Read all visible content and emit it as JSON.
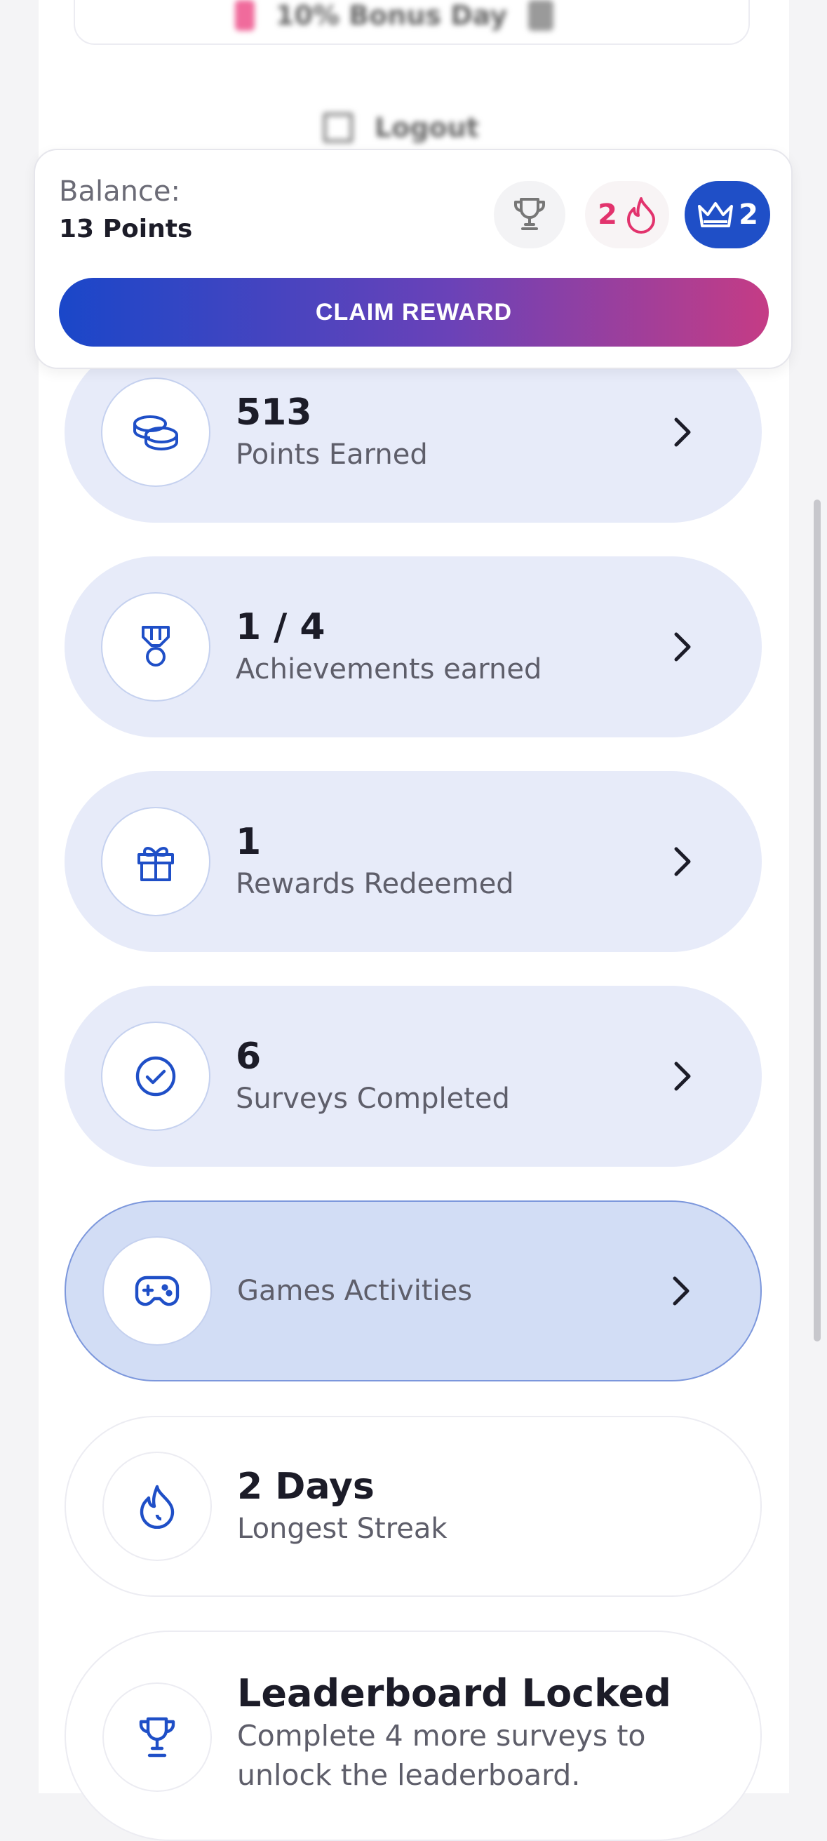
{
  "behind": {
    "bonus_text": "10% Bonus Day",
    "logout_text": "Logout"
  },
  "balance": {
    "label": "Balance:",
    "points": "13 Points",
    "streak_count": "2",
    "crown_count": "2",
    "claim_label": "CLAIM REWARD"
  },
  "stats": [
    {
      "value": "513",
      "label": "Points Earned",
      "icon": "coins-icon"
    },
    {
      "value": "1 / 4",
      "label": "Achievements earned",
      "icon": "medal-icon"
    },
    {
      "value": "1",
      "label": "Rewards Redeemed",
      "icon": "gift-icon"
    },
    {
      "value": "6",
      "label": "Surveys Completed",
      "icon": "check-circle-icon"
    },
    {
      "value": "",
      "label": "Games Activities",
      "icon": "gamepad-icon"
    },
    {
      "value": "2 Days",
      "label": "Longest Streak",
      "icon": "flame-icon"
    }
  ],
  "leaderboard": {
    "title": "Leaderboard Locked",
    "subtitle": "Complete 4 more surveys to unlock the leaderboard.",
    "icon": "trophy-icon"
  },
  "colors": {
    "accent_blue": "#1f4fc7",
    "streak_pink": "#e2336d",
    "card_blue": "#e7ebf9",
    "card_active": "#d2ddf5"
  }
}
